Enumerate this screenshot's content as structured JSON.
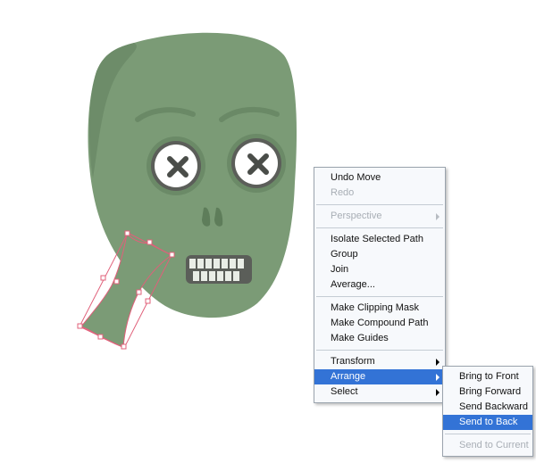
{
  "context_menu": {
    "items": [
      {
        "label": "Undo Move",
        "enabled": true
      },
      {
        "label": "Redo",
        "enabled": false
      },
      {
        "label": "Perspective",
        "enabled": false,
        "submenu": true
      },
      {
        "label": "Isolate Selected Path",
        "enabled": true
      },
      {
        "label": "Group",
        "enabled": true
      },
      {
        "label": "Join",
        "enabled": true
      },
      {
        "label": "Average...",
        "enabled": true
      },
      {
        "label": "Make Clipping Mask",
        "enabled": true
      },
      {
        "label": "Make Compound Path",
        "enabled": true
      },
      {
        "label": "Make Guides",
        "enabled": true
      },
      {
        "label": "Transform",
        "enabled": true,
        "submenu": true
      },
      {
        "label": "Arrange",
        "enabled": true,
        "submenu": true,
        "highlighted": true
      },
      {
        "label": "Select",
        "enabled": true,
        "submenu": true
      }
    ]
  },
  "arrange_submenu": {
    "items": [
      {
        "label": "Bring to Front",
        "enabled": true
      },
      {
        "label": "Bring Forward",
        "enabled": true
      },
      {
        "label": "Send Backward",
        "enabled": true
      },
      {
        "label": "Send to Back",
        "enabled": true,
        "highlighted": true
      },
      {
        "label": "Send to Current",
        "enabled": false
      }
    ]
  },
  "colors": {
    "skull_fill": "#7b9b76",
    "skull_shade": "#6d8c69",
    "eye_ring": "#5b5e59",
    "cross": "#4a4d49",
    "selection": "#e0607a",
    "menu_highlight": "#3373d6"
  }
}
